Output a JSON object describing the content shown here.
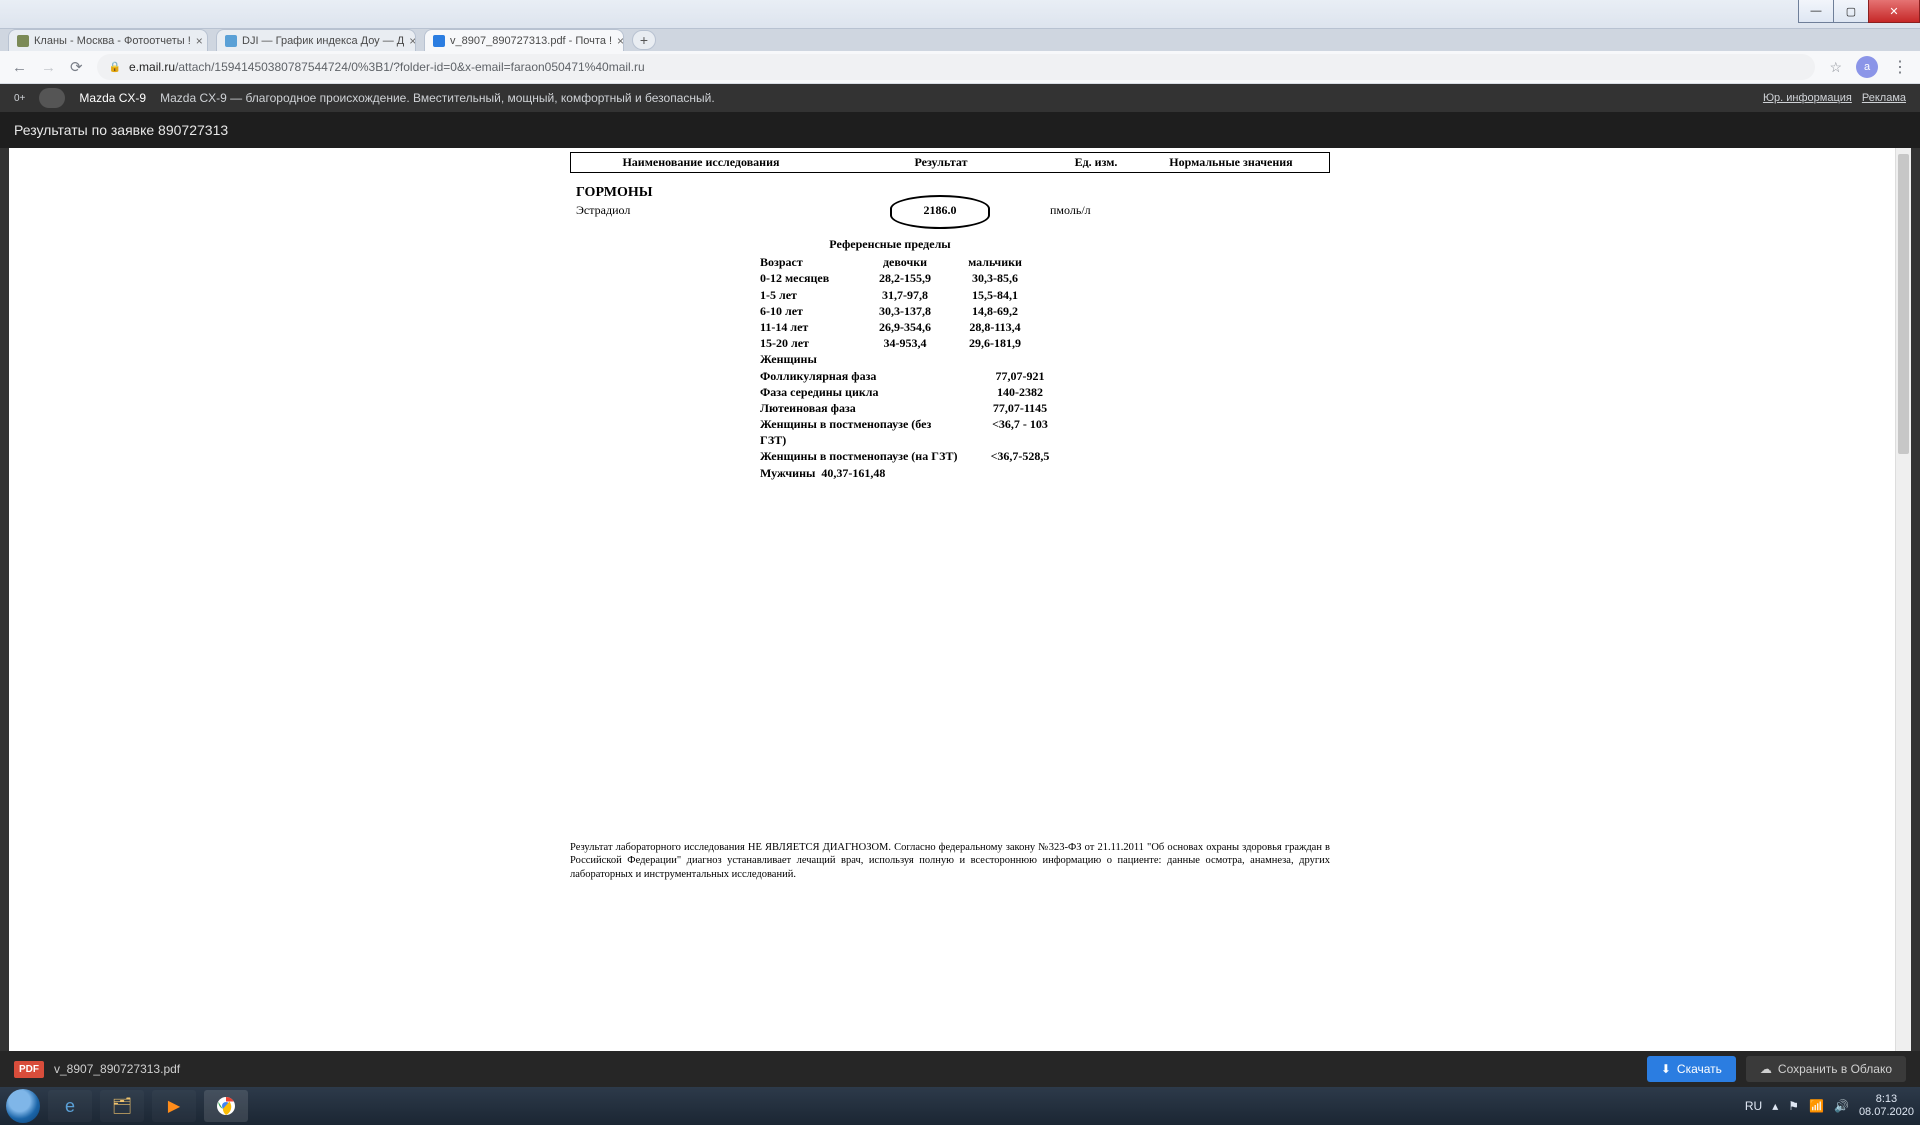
{
  "window_buttons": {
    "min": "—",
    "max": "▢",
    "close": "✕"
  },
  "tabs": [
    {
      "favicon": "#7b8a56",
      "title": "Кланы - Москва - Фотоотчеты !"
    },
    {
      "favicon": "#5aa0d6",
      "title": "DJI — График индекса Доу — Д"
    },
    {
      "favicon": "#2b7de1",
      "title": "v_8907_890727313.pdf - Почта !"
    }
  ],
  "newtab": "+",
  "nav": {
    "back": "←",
    "fwd": "→",
    "reload": "⟳"
  },
  "addr": {
    "lock": "🔒",
    "host": "e.mail.ru",
    "path": "/attach/15941450380787544724/0%3B1/?folder-id=0&x-email=faraon050471%40mail.ru",
    "star": "☆",
    "avatar": "a",
    "kebab": "⋮"
  },
  "ad": {
    "age": "0+",
    "brand": "Mazda CX-9",
    "text": "Mazda CX-9 — благородное происхождение. Вместительный, мощный, комфортный и безопасный.",
    "r1": "Юр. информация",
    "r2": "Реклама"
  },
  "page_header": "Результаты по заявке 890727313",
  "doc": {
    "headers": {
      "c1": "Наименование исследования",
      "c2": "Результат",
      "c3": "Ед. изм.",
      "c4": "Нормальные значения"
    },
    "section": "ГОРМОНЫ",
    "analyte": "Эстрадиол",
    "value": "2186.0",
    "unit": "пмоль/л",
    "ref_title": "Референсные пределы",
    "ref_head": {
      "age": "Возраст",
      "girls": "девочки",
      "boys": "мальчики"
    },
    "ref_rows": [
      {
        "age": "0-12 месяцев",
        "g": "28,2-155,9",
        "b": "30,3-85,6"
      },
      {
        "age": "1-5 лет",
        "g": "31,7-97,8",
        "b": "15,5-84,1"
      },
      {
        "age": "6-10 лет",
        "g": "30,3-137,8",
        "b": "14,8-69,2"
      },
      {
        "age": "11-14 лет",
        "g": "26,9-354,6",
        "b": "28,8-113,4"
      },
      {
        "age": "15-20 лет",
        "g": "34-953,4",
        "b": "29,6-181,9"
      }
    ],
    "women_label": "Женщины",
    "phases": [
      {
        "n": "Фолликулярная фаза",
        "v": "77,07-921"
      },
      {
        "n": "Фаза середины цикла",
        "v": "140-2382"
      },
      {
        "n": "Лютеиновая фаза",
        "v": "77,07-1145"
      },
      {
        "n": "Женщины в постменопаузе (без ГЗТ)",
        "v": "<36,7 - 103"
      },
      {
        "n": "Женщины в постменопаузе (на ГЗТ)",
        "v": "<36,7-528,5"
      }
    ],
    "men": {
      "n": "Мужчины",
      "v": "40,37-161,48"
    },
    "footnote": "Результат лабораторного исследования НЕ ЯВЛЯЕТСЯ ДИАГНОЗОМ. Согласно федеральному закону №323-ФЗ от 21.11.2011 \"Об основах охраны здоровья граждан в Российской Федерации\" диагноз устанавливает лечащий врач, используя полную и всестороннюю информацию о пациенте: данные осмотра, анамнеза, других лабораторных и инструментальных исследований."
  },
  "download": {
    "badge": "PDF",
    "file": "v_8907_890727313.pdf",
    "btn": "Скачать",
    "cloud": "Сохранить в Облако",
    "dl_icon": "⬇",
    "cloud_icon": "☁"
  },
  "tray": {
    "lang": "RU",
    "up": "▴",
    "flag": "⚑",
    "net": "📶",
    "vol": "🔊",
    "time": "8:13",
    "date": "08.07.2020"
  }
}
